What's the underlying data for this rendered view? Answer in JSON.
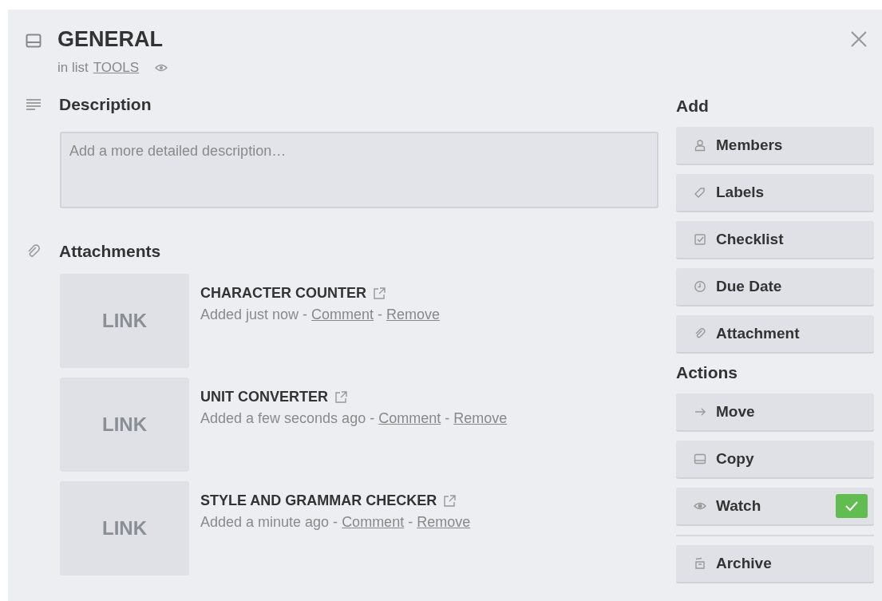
{
  "card": {
    "title": "GENERAL",
    "list_prefix": "in list",
    "list_name": "TOOLS",
    "watching": true
  },
  "description": {
    "heading": "Description",
    "placeholder": "Add a more detailed description…"
  },
  "attachments": {
    "heading": "Attachments",
    "items": [
      {
        "thumb": "LINK",
        "name": "CHARACTER COUNTER",
        "meta": [
          {
            "kind": "text",
            "text": "Added just now -"
          },
          {
            "kind": "link",
            "text": "Comment"
          },
          {
            "kind": "text",
            "text": "-"
          },
          {
            "kind": "link",
            "text": "Remove"
          }
        ]
      },
      {
        "thumb": "LINK",
        "name": "UNIT CONVERTER",
        "meta": [
          {
            "kind": "text",
            "text": "Added a few seconds ago -"
          },
          {
            "kind": "link",
            "text": "Comment"
          },
          {
            "kind": "text",
            "text": "-"
          },
          {
            "kind": "link",
            "text": "Remove"
          }
        ]
      },
      {
        "thumb": "LINK",
        "name": "STYLE AND GRAMMAR CHECKER",
        "meta": [
          {
            "kind": "text",
            "text": "Added a minute ago -"
          },
          {
            "kind": "link",
            "text": "Comment"
          },
          {
            "kind": "text",
            "text": "-"
          },
          {
            "kind": "link",
            "text": "Remove"
          }
        ]
      }
    ]
  },
  "add": {
    "heading": "Add",
    "buttons": [
      {
        "kind": "person",
        "label": "Members"
      },
      {
        "kind": "tag",
        "label": "Labels"
      },
      {
        "kind": "checkbox",
        "label": "Checklist"
      },
      {
        "kind": "clock",
        "label": "Due Date"
      },
      {
        "kind": "paperclip",
        "label": "Attachment"
      }
    ]
  },
  "actions": {
    "heading": "Actions",
    "buttons": [
      {
        "kind": "arrow",
        "label": "Move",
        "divider_after": false
      },
      {
        "kind": "card",
        "label": "Copy",
        "divider_after": false
      },
      {
        "kind": "eye",
        "label": "Watch",
        "checked": true,
        "divider_after": true
      },
      {
        "kind": "archive",
        "label": "Archive",
        "divider_after": false
      }
    ]
  }
}
